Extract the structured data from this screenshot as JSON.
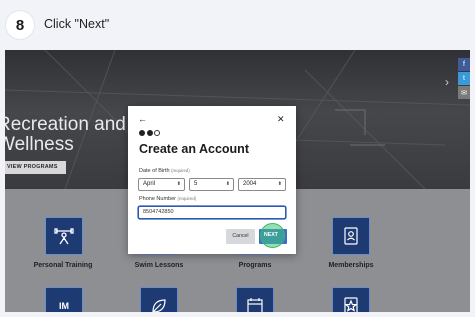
{
  "step": {
    "number": "8",
    "instruction": "Click \"Next\""
  },
  "hero": {
    "title_line1": "Recreation and",
    "title_line2": "Wellness",
    "cta_label": "VIEW PROGRAMS",
    "arrow_glyph": "›"
  },
  "share": {
    "facebook": "f",
    "twitter": "t",
    "email": "✉"
  },
  "tiles": [
    {
      "label": "Personal Training",
      "icon": "dumbbell-person-icon"
    },
    {
      "label": "Swim Lessons",
      "icon": "swimmer-icon"
    },
    {
      "label": "Programs",
      "icon": "star-icon"
    },
    {
      "label": "Memberships",
      "icon": "member-card-icon"
    },
    {
      "label": "IM",
      "icon": "im-icon"
    },
    {
      "label": "",
      "icon": "leaf-icon"
    },
    {
      "label": "",
      "icon": "calendar-icon"
    },
    {
      "label": "",
      "icon": "star-badge-icon"
    }
  ],
  "modal": {
    "back_glyph": "←",
    "close_glyph": "✕",
    "step_progress": {
      "current": 2,
      "total": 3
    },
    "title": "Create an Account",
    "dob_label": "Date of Birth",
    "dob_required": "(required)",
    "month": "April",
    "day": "5",
    "year": "2004",
    "phone_label": "Phone Number",
    "phone_required": "(required)",
    "phone_value": "8504742850",
    "cancel_label": "Cancel",
    "next_label": "NEXT"
  },
  "colors": {
    "accent": "#3d6fc9",
    "tile_blue": "#1d3a72",
    "click_highlight": "#39b86a"
  }
}
